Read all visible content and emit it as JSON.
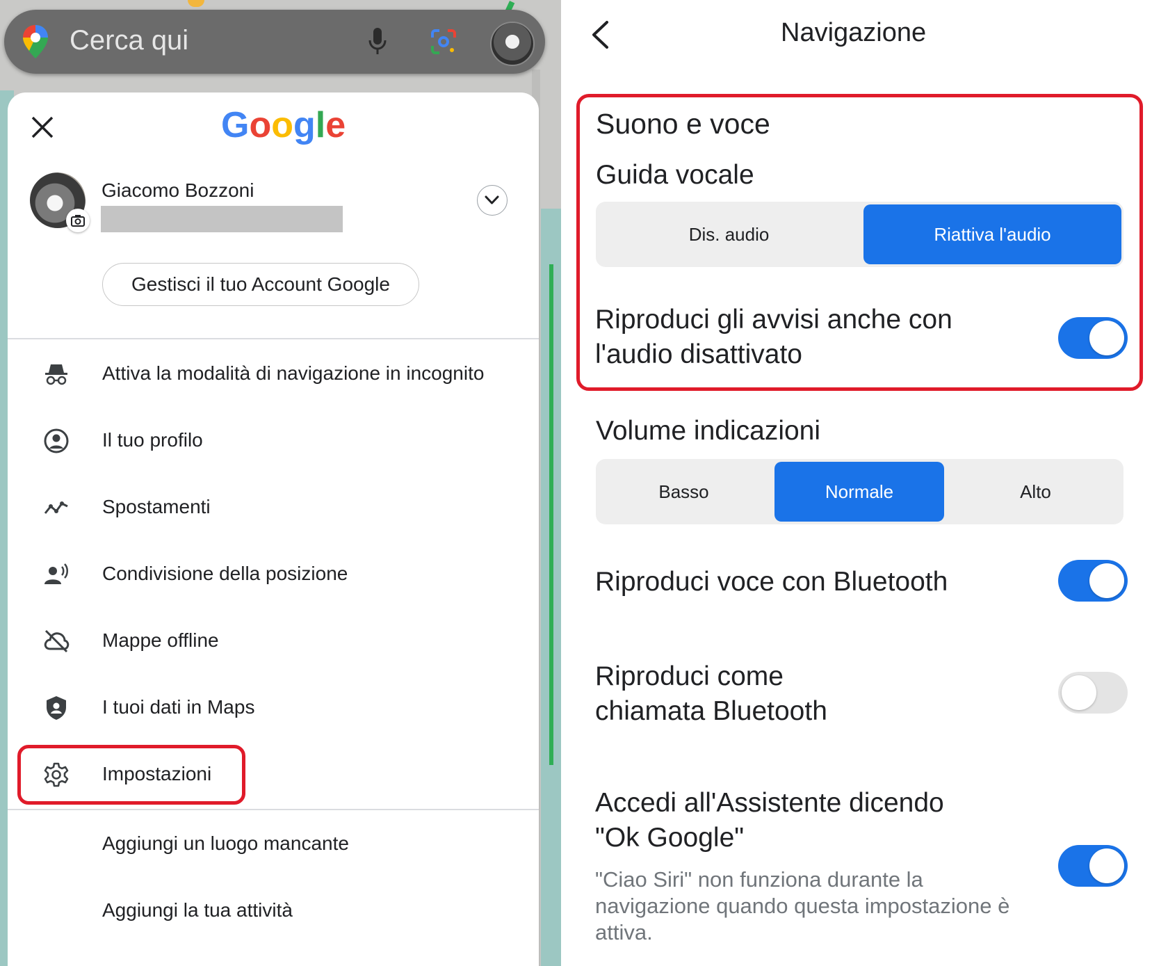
{
  "left": {
    "search": {
      "placeholder": "Cerca qui"
    },
    "sheet": {
      "brand": "Google",
      "account": {
        "name": "Giacomo Bozzoni"
      },
      "manage_label": "Gestisci il tuo Account Google",
      "menu": [
        {
          "icon": "incognito-icon",
          "label": "Attiva la modalità di navigazione in incognito"
        },
        {
          "icon": "profile-icon",
          "label": "Il tuo profilo"
        },
        {
          "icon": "timeline-icon",
          "label": "Spostamenti"
        },
        {
          "icon": "location-sharing-icon",
          "label": "Condivisione della posizione"
        },
        {
          "icon": "cloud-off-icon",
          "label": "Mappe offline"
        },
        {
          "icon": "shield-person-icon",
          "label": "I tuoi dati in Maps"
        },
        {
          "icon": "gear-icon",
          "label": "Impostazioni"
        }
      ],
      "extra": [
        {
          "label": "Aggiungi un luogo mancante"
        },
        {
          "label": "Aggiungi la tua attività"
        }
      ]
    }
  },
  "right": {
    "title": "Navigazione",
    "sound_section": {
      "title": "Suono e voce",
      "voice_guide": {
        "label": "Guida vocale",
        "options": [
          "Dis. audio",
          "Riattiva l'audio"
        ],
        "selected": "Riattiva l'audio"
      },
      "play_alerts": {
        "line1": "Riproduci gli avvisi anche con",
        "line2": "l'audio disattivato",
        "on": true
      }
    },
    "volume": {
      "label": "Volume indicazioni",
      "options": [
        "Basso",
        "Normale",
        "Alto"
      ],
      "selected": "Normale"
    },
    "bluetooth_voice": {
      "label": "Riproduci voce con Bluetooth",
      "on": true
    },
    "bluetooth_call": {
      "line1": "Riproduci come",
      "line2": "chiamata Bluetooth",
      "on": false
    },
    "assistant": {
      "line1": "Accedi all'Assistente dicendo",
      "line2": "\"Ok Google\"",
      "sub1": "\"Ciao Siri\" non funziona durante la",
      "sub2": "navigazione quando questa impostazione è",
      "sub3": "attiva.",
      "on": true
    }
  },
  "colors": {
    "accent": "#1a73e8",
    "highlight": "#e01b2a"
  }
}
